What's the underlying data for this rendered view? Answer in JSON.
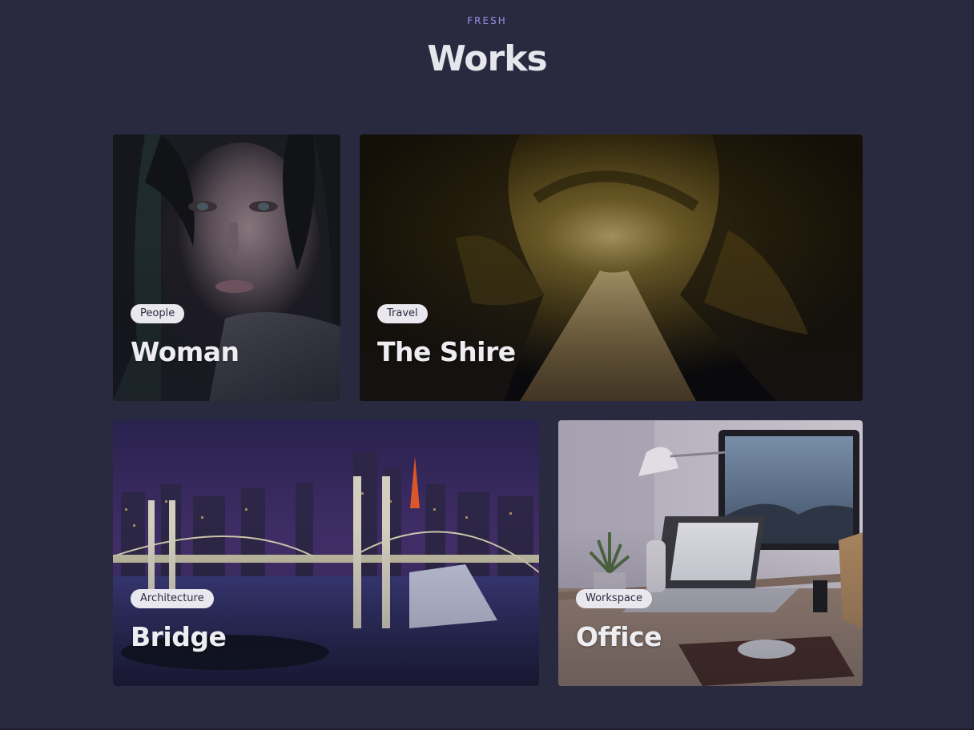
{
  "header": {
    "eyebrow": "FRESH",
    "title": "Works"
  },
  "works": [
    {
      "category": "People",
      "title": "Woman"
    },
    {
      "category": "Travel",
      "title": "The Shire"
    },
    {
      "category": "Architecture",
      "title": "Bridge"
    },
    {
      "category": "Workspace",
      "title": "Office"
    }
  ],
  "colors": {
    "background": "#292a40",
    "accent": "#9a8fe6",
    "tag_background": "#e9e8ee",
    "title_text": "#ececf2"
  }
}
